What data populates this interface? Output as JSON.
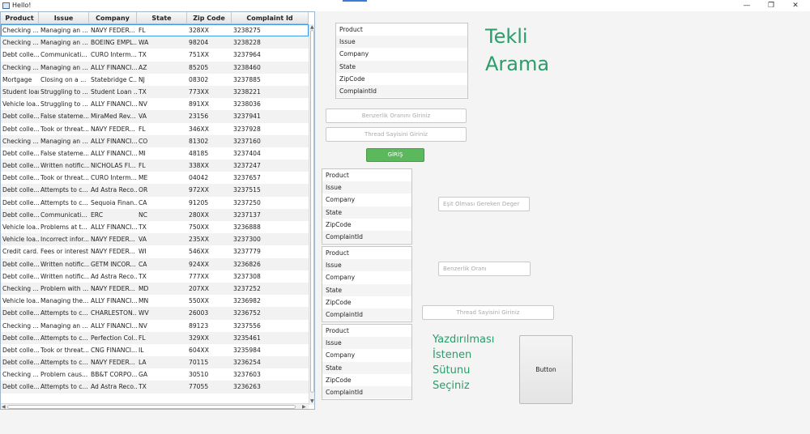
{
  "window": {
    "title": "Hello!",
    "controls": {
      "minimize": "—",
      "maximize": "❐",
      "close": "✕"
    }
  },
  "table": {
    "columns": [
      "Product",
      "Issue",
      "Company",
      "State",
      "Zip Code",
      "Complaint Id"
    ],
    "rows": [
      [
        "Checking ...",
        "Managing an ...",
        "NAVY FEDER...",
        "FL",
        "328XX",
        "3238275"
      ],
      [
        "Checking ...",
        "Managing an ...",
        "BOEING EMPL...",
        "WA",
        "98204",
        "3238228"
      ],
      [
        "Debt colle...",
        "Communicati...",
        "CURO Interm...",
        "TX",
        "751XX",
        "3237964"
      ],
      [
        "Checking ...",
        "Managing an ...",
        "ALLY FINANCI...",
        "AZ",
        "85205",
        "3238460"
      ],
      [
        "Mortgage",
        "Closing on a ...",
        "Statebridge C...",
        "NJ",
        "08302",
        "3237885"
      ],
      [
        "Student loan",
        "Struggling to ...",
        "Student Loan ...",
        "TX",
        "773XX",
        "3238221"
      ],
      [
        "Vehicle loa...",
        "Struggling to ...",
        "ALLY FINANCI...",
        "NV",
        "891XX",
        "3238036"
      ],
      [
        "Debt colle...",
        "False stateme...",
        "MiraMed Rev...",
        "VA",
        "23156",
        "3237941"
      ],
      [
        "Debt colle...",
        "Took or threat...",
        "NAVY FEDER...",
        "FL",
        "346XX",
        "3237928"
      ],
      [
        "Checking ...",
        "Managing an ...",
        "ALLY FINANCI...",
        "CO",
        "81302",
        "3237160"
      ],
      [
        "Debt colle...",
        "False stateme...",
        "ALLY FINANCI...",
        "MI",
        "48185",
        "3237404"
      ],
      [
        "Debt colle...",
        "Written notific...",
        "NICHOLAS FI...",
        "FL",
        "338XX",
        "3237247"
      ],
      [
        "Debt colle...",
        "Took or threat...",
        "CURO Interm...",
        "ME",
        "04042",
        "3237657"
      ],
      [
        "Debt colle...",
        "Attempts to c...",
        "Ad Astra Reco...",
        "OR",
        "972XX",
        "3237515"
      ],
      [
        "Debt colle...",
        "Attempts to c...",
        "Sequoia Finan...",
        "CA",
        "91205",
        "3237250"
      ],
      [
        "Debt colle...",
        "Communicati...",
        "ERC",
        "NC",
        "280XX",
        "3237137"
      ],
      [
        "Vehicle loa...",
        "Problems at t...",
        "ALLY FINANCI...",
        "TX",
        "750XX",
        "3236888"
      ],
      [
        "Vehicle loa...",
        "Incorrect infor...",
        "NAVY FEDER...",
        "VA",
        "235XX",
        "3237300"
      ],
      [
        "Credit card...",
        "Fees or interest",
        "NAVY FEDER...",
        "WI",
        "546XX",
        "3237779"
      ],
      [
        "Debt colle...",
        "Written notific...",
        "GETM INCOR...",
        "CA",
        "924XX",
        "3236826"
      ],
      [
        "Debt colle...",
        "Written notific...",
        "Ad Astra Reco...",
        "TX",
        "777XX",
        "3237308"
      ],
      [
        "Checking ...",
        "Problem with ...",
        "NAVY FEDER...",
        "MD",
        "207XX",
        "3237252"
      ],
      [
        "Vehicle loa...",
        "Managing the...",
        "ALLY FINANCI...",
        "MN",
        "550XX",
        "3236982"
      ],
      [
        "Debt colle...",
        "Attempts to c...",
        "CHARLESTON...",
        "WV",
        "26003",
        "3236752"
      ],
      [
        "Checking ...",
        "Managing an ...",
        "ALLY FINANCI...",
        "NV",
        "89123",
        "3237556"
      ],
      [
        "Debt colle...",
        "Attempts to c...",
        "Perfection Col...",
        "FL",
        "329XX",
        "3235461"
      ],
      [
        "Debt colle...",
        "Took or threat...",
        "CNG FINANCI...",
        "IL",
        "604XX",
        "3235984"
      ],
      [
        "Debt colle...",
        "Attempts to c...",
        "NAVY FEDER...",
        "LA",
        "70115",
        "3236254"
      ],
      [
        "Checking ...",
        "Problem caus...",
        "BB&T CORPO...",
        "GA",
        "30510",
        "3237603"
      ],
      [
        "Debt colle...",
        "Attempts to c...",
        "Ad Astra Reco...",
        "TX",
        "77055",
        "3236263"
      ]
    ]
  },
  "column_list_items": [
    "Product",
    "Issue",
    "Company",
    "State",
    "ZipCode",
    "ComplaintId"
  ],
  "single_search": {
    "heading_line1": "Tekli",
    "heading_line2": "Arama",
    "similarity_placeholder": "Benzerlik Oranını Giriniz",
    "thread_placeholder": "Thread Sayisini Giriniz",
    "submit_label": "GİRİŞ"
  },
  "multi_search": {
    "equal_value_placeholder": "Eşit Olması Gereken Deger",
    "similarity_placeholder": "Benzerlik Oranı",
    "thread_placeholder": "Thread Sayisini Giriniz",
    "heading_lines": [
      "Yazdırılması",
      "İstenen",
      "Sütunu",
      "Seçiniz"
    ],
    "button_label": "Button"
  },
  "colors": {
    "accent_green": "#2a9d6a",
    "submit_green": "#5cb85c",
    "selection_blue": "#3d9be9"
  }
}
